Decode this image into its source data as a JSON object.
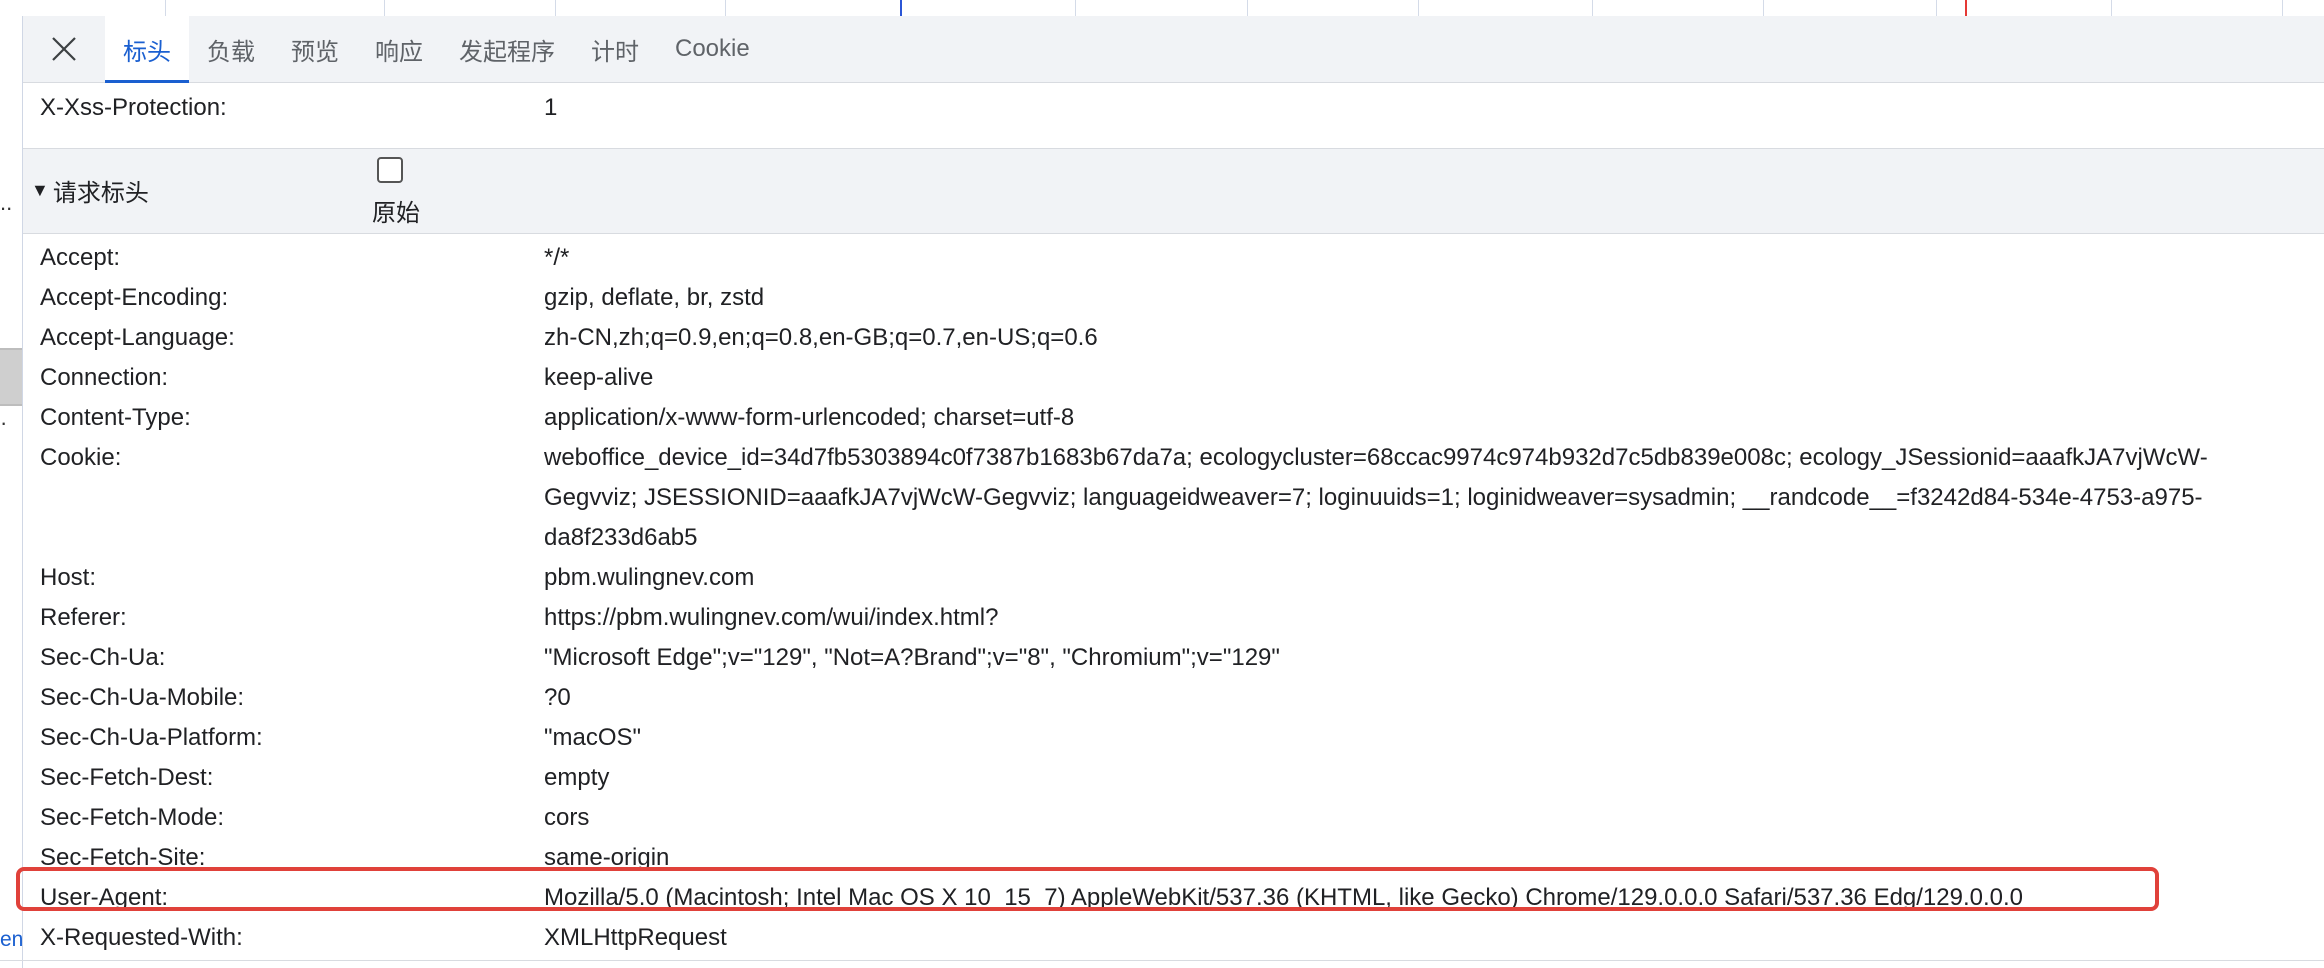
{
  "tabs": [
    {
      "label": "标头",
      "active": true
    },
    {
      "label": "负载",
      "active": false
    },
    {
      "label": "预览",
      "active": false
    },
    {
      "label": "响应",
      "active": false
    },
    {
      "label": "发起程序",
      "active": false
    },
    {
      "label": "计时",
      "active": false
    },
    {
      "label": "Cookie",
      "active": false
    }
  ],
  "response_headers_tail": [
    {
      "name": "X-Xss-Protection:",
      "value": "1"
    }
  ],
  "request_section": {
    "title": "请求标头",
    "raw_label": "原始",
    "raw_checked": false
  },
  "request_headers": [
    {
      "name": "Accept:",
      "value": "*/*"
    },
    {
      "name": "Accept-Encoding:",
      "value": "gzip, deflate, br, zstd"
    },
    {
      "name": "Accept-Language:",
      "value": "zh-CN,zh;q=0.9,en;q=0.8,en-GB;q=0.7,en-US;q=0.6"
    },
    {
      "name": "Connection:",
      "value": "keep-alive"
    },
    {
      "name": "Content-Type:",
      "value": "application/x-www-form-urlencoded; charset=utf-8"
    },
    {
      "name": "Cookie:",
      "value_lines": [
        "weboffice_device_id=34d7fb5303894c0f7387b1683b67da7a; ecologycluster=68ccac9974c974b932d7c5db839e008c; ecology_JSessionid=aaafkJA7vjWcW-",
        "Gegvviz; JSESSIONID=aaafkJA7vjWcW-Gegvviz; languageidweaver=7; loginuuids=1; loginidweaver=sysadmin; __randcode__=f3242d84-534e-4753-a975-",
        "da8f233d6ab5"
      ]
    },
    {
      "name": "Host:",
      "value": "pbm.wulingnev.com"
    },
    {
      "name": "Referer:",
      "value": "https://pbm.wulingnev.com/wui/index.html?"
    },
    {
      "name": "Sec-Ch-Ua:",
      "value": "\"Microsoft Edge\";v=\"129\", \"Not=A?Brand\";v=\"8\", \"Chromium\";v=\"129\""
    },
    {
      "name": "Sec-Ch-Ua-Mobile:",
      "value": "?0"
    },
    {
      "name": "Sec-Ch-Ua-Platform:",
      "value": "\"macOS\""
    },
    {
      "name": "Sec-Fetch-Dest:",
      "value": "empty"
    },
    {
      "name": "Sec-Fetch-Mode:",
      "value": "cors"
    },
    {
      "name": "Sec-Fetch-Site:",
      "value": "same-origin"
    },
    {
      "name": "User-Agent:",
      "value": "Mozilla/5.0 (Macintosh; Intel Mac OS X 10_15_7) AppleWebKit/537.36 (KHTML, like Gecko) Chrome/129.0.0.0 Safari/537.36 Edg/129.0.0.0",
      "highlighted": true
    },
    {
      "name": "X-Requested-With:",
      "value": "XMLHttpRequest"
    }
  ],
  "left_gutter": {
    "marks": [
      "..",
      "..",
      "·"
    ],
    "partial_text": "ent"
  },
  "colors": {
    "accent": "#1a5fd0",
    "highlight_border": "#e0413a",
    "tab_bar_bg": "#f1f3f6"
  },
  "icons": {
    "close": "close-icon",
    "expand": "triangle-down-icon"
  }
}
